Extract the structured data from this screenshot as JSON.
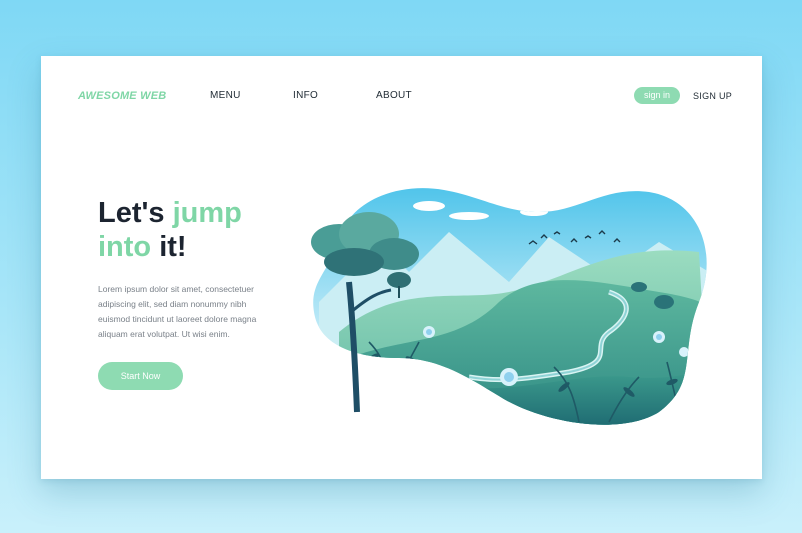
{
  "header": {
    "logo": "AWESOME WEB",
    "nav": [
      "MENU",
      "INFO",
      "ABOUT"
    ],
    "sign_in": "sign in",
    "sign_up": "SIGN UP"
  },
  "hero": {
    "title_line1_a": "Let's ",
    "title_line1_b": "jump",
    "title_line2_a": "into",
    "title_line2_b": " it!",
    "text": "Lorem ipsum dolor sit amet, consectetuer adipiscing elit, sed diam nonummy nibh euismod tincidunt ut laoreet dolore magna aliquam erat volutpat. Ut wisi enim.",
    "cta": "Start Now"
  },
  "colors": {
    "accent": "#7fd6a6",
    "dark_text": "#1c2430",
    "background_top": "#7fd8f5"
  },
  "icons": [
    "landscape-illustration"
  ]
}
